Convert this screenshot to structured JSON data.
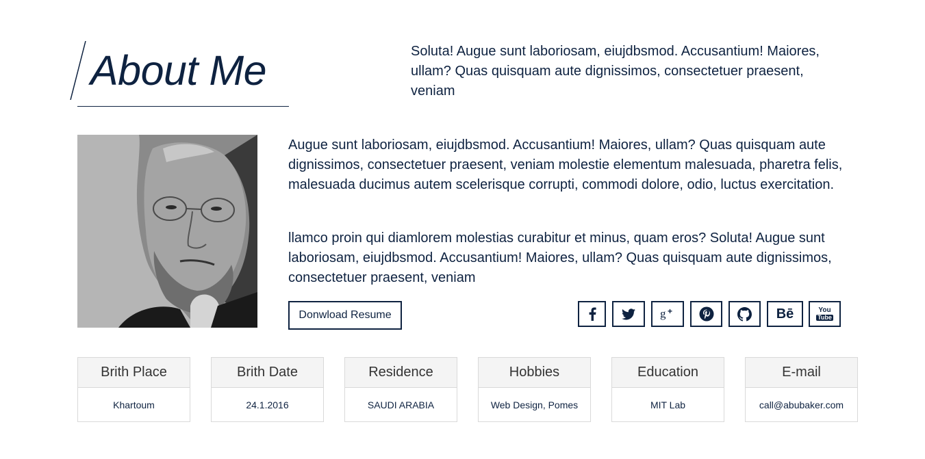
{
  "header": {
    "title": "About Me",
    "intro": "Soluta! Augue sunt laboriosam, eiujdbsmod. Accusantium! Maiores, ullam? Quas quisquam aute dignissimos, consectetuer praesent, veniam"
  },
  "body": {
    "paragraph1": "Augue sunt laboriosam, eiujdbsmod. Accusantium! Maiores, ullam? Quas quisquam aute dignissimos, consectetuer praesent, veniam molestie elementum malesuada, pharetra felis, malesuada ducimus autem scelerisque corrupti, commodi dolore, odio, luctus exercitation.",
    "paragraph2": "llamco proin qui diamlorem molestias curabitur et minus, quam eros? Soluta! Augue sunt laboriosam, eiujdbsmod. Accusantium! Maiores, ullam? Quas quisquam aute dignissimos, consectetuer praesent, veniam",
    "download_label": "Donwload Resume"
  },
  "socials": [
    {
      "icon": "facebook-icon"
    },
    {
      "icon": "twitter-icon"
    },
    {
      "icon": "google-plus-icon"
    },
    {
      "icon": "pinterest-icon"
    },
    {
      "icon": "github-icon"
    },
    {
      "icon": "behance-icon",
      "text": "Bē"
    },
    {
      "icon": "youtube-icon",
      "text_top": "You",
      "text_bottom": "Tube"
    }
  ],
  "info": [
    {
      "label": "Brith Place",
      "value": "Khartoum"
    },
    {
      "label": "Brith Date",
      "value": "24.1.2016"
    },
    {
      "label": "Residence",
      "value": "SAUDI ARABIA"
    },
    {
      "label": "Hobbies",
      "value": "Web Design, Pomes"
    },
    {
      "label": "Education",
      "value": "MIT Lab"
    },
    {
      "label": "E-mail",
      "value": "call@abubaker.com"
    }
  ],
  "colors": {
    "primary": "#0e2240",
    "card_head_bg": "#f4f4f4",
    "card_border": "#d9d9d9"
  }
}
